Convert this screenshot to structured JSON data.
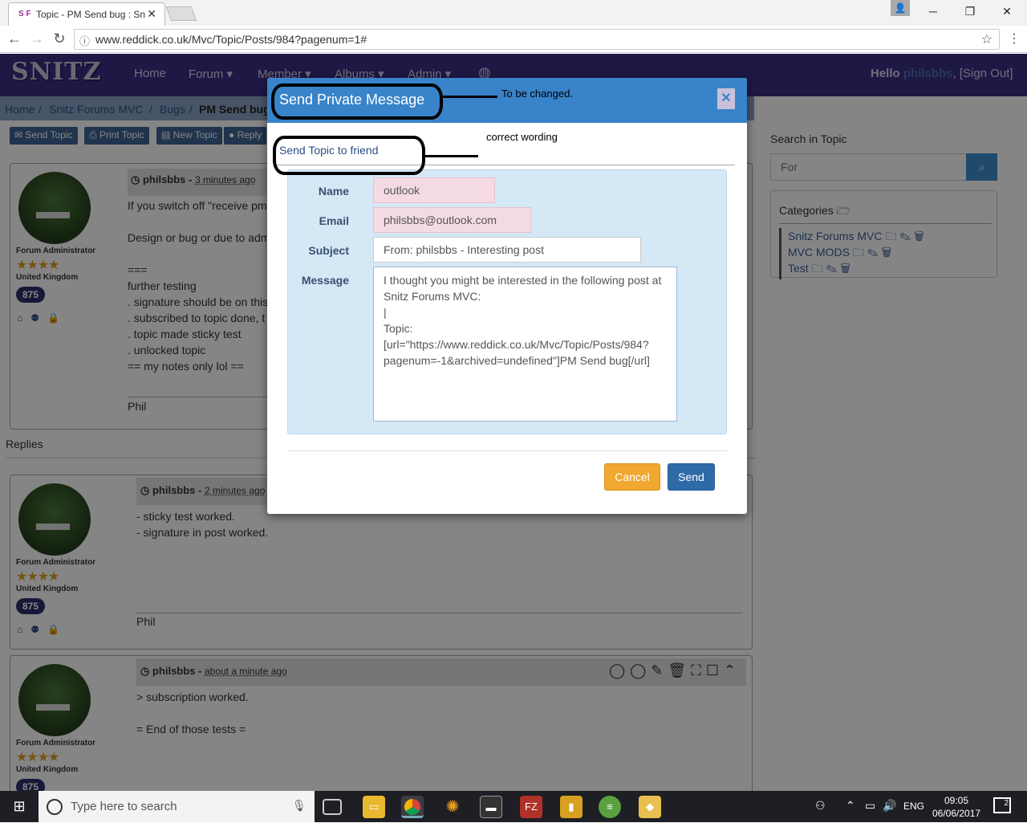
{
  "browser": {
    "tab_title": "Topic - PM Send bug : Sn",
    "tab_icon": "S F",
    "url": "www.reddick.co.uk/Mvc/Topic/Posts/984?pagenum=1#"
  },
  "site": {
    "logo": "SNITZ",
    "nav": [
      "Home",
      "Forum ▾",
      "Member ▾",
      "Albums ▾",
      "Admin ▾"
    ],
    "hello_prefix": "Hello ",
    "username": "philsbbs",
    "signout": ", [Sign Out]"
  },
  "breadcrumb": [
    "Home",
    "/",
    "Snitz Forums MVC",
    "/",
    "Bugs",
    "/",
    "PM Send bug"
  ],
  "toolbar": [
    "Send Topic",
    "Print Topic",
    "New Topic",
    "Reply"
  ],
  "posts": [
    {
      "author": "philsbbs",
      "ago": "3 minutes ago",
      "role": "Forum Administrator",
      "country": "United Kingdom",
      "count": "875",
      "text": "If you switch off \"receive pm\n\nDesign or bug or due to adm\n\n===\nfurther testing\n. signature should be on this\n. subscribed to topic done, t\n. topic made sticky test\n. unlocked topic\n== my notes only lol ==",
      "signature": "Phil"
    },
    {
      "author": "philsbbs",
      "ago": "2 minutes ago",
      "role": "Forum Administrator",
      "country": "United Kingdom",
      "count": "875",
      "text": "- sticky test worked.\n- signature in post worked.",
      "signature": "Phil"
    },
    {
      "author": "philsbbs",
      "ago": "about a minute ago",
      "role": "Forum Administrator",
      "country": "United Kingdom",
      "count": "875",
      "text": "> subscription worked.\n\n= End of those tests =",
      "signature": ""
    }
  ],
  "replies_label": "Replies",
  "sidebar": {
    "search_label": "Search in Topic",
    "search_placeholder": "For",
    "categories_label": "Categories",
    "categories": [
      "Snitz Forums MVC",
      "MVC MODS",
      "Test"
    ]
  },
  "modal": {
    "title": "Send Private Message",
    "subtitle": "Send Topic to friend",
    "fields": {
      "name_label": "Name",
      "name_value": "outlook",
      "email_label": "Email",
      "email_value": "philsbbs@outlook.com",
      "subject_label": "Subject",
      "subject_value": "From: philsbbs - Interesting post",
      "message_label": "Message",
      "message_value": "I thought you might be interested in the following post at Snitz Forums MVC:\n|\nTopic:\n[url=\"https://www.reddick.co.uk/Mvc/Topic/Posts/984?pagenum=-1&archived=undefined\"]PM Send bug[/url]"
    },
    "cancel_label": "Cancel",
    "send_label": "Send"
  },
  "annotations": {
    "note1": "To be changed.",
    "note2": "correct wording"
  },
  "taskbar": {
    "search_placeholder": "Type here to search",
    "lang": "ENG",
    "time": "09:05",
    "date": "06/06/2017",
    "notif_count": "2"
  },
  "colors": {
    "navbar": "#3a2f85",
    "modal_header": "#3883c9",
    "send_button": "#2f6aa8",
    "cancel_button": "#f0a830",
    "error_field": "#f4dbe3"
  }
}
